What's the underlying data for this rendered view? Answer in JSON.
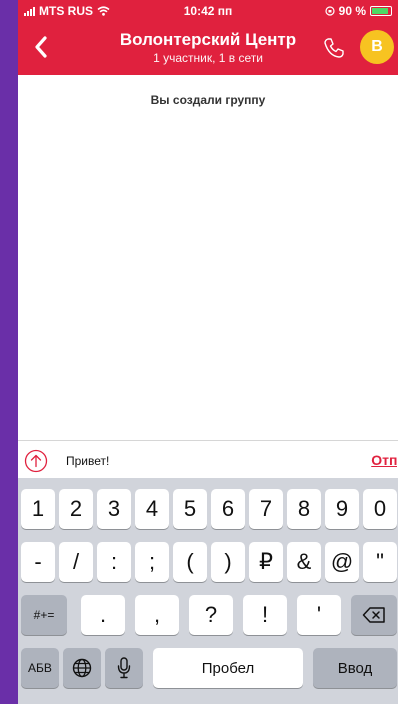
{
  "status_bar": {
    "carrier": "MTS RUS",
    "time": "10:42 пп",
    "battery_percent": "90 %"
  },
  "header": {
    "title": "Волонтерский Центр",
    "subtitle": "1 участник, 1 в сети",
    "avatar_letter": "В"
  },
  "chat": {
    "system_message": "Вы создали группу"
  },
  "composer": {
    "input_value": "Привет!",
    "send_label": "Отпр"
  },
  "keyboard": {
    "row1": [
      "1",
      "2",
      "3",
      "4",
      "5",
      "6",
      "7",
      "8",
      "9",
      "0"
    ],
    "row2": [
      "-",
      "/",
      ":",
      ";",
      "(",
      ")",
      "₽",
      "&",
      "@",
      "\""
    ],
    "row3_left": "#+=",
    "row3": [
      ".",
      ",",
      "?",
      "!",
      "'"
    ],
    "row4_abc": "АБВ",
    "row4_space": "Пробел",
    "row4_enter": "Ввод"
  },
  "colors": {
    "brand": "#e0213e",
    "avatar": "#f7c321",
    "background": "#6a2fa8"
  }
}
